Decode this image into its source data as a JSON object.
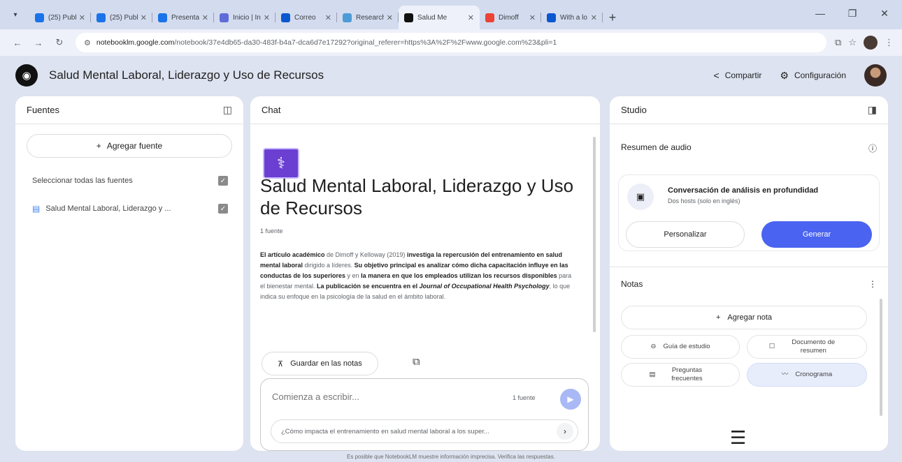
{
  "browser": {
    "tabs": [
      {
        "title": "(25) Publ",
        "color": "#1a73e8"
      },
      {
        "title": "(25) Publ",
        "color": "#1a73e8"
      },
      {
        "title": "Presenta",
        "color": "#1a73e8"
      },
      {
        "title": "Inicio | In",
        "color": "#5f6bd8"
      },
      {
        "title": "Correo",
        "color": "#0b57d0"
      },
      {
        "title": "Research",
        "color": "#4d9bd6"
      },
      {
        "title": "Salud Me",
        "color": "#111111"
      },
      {
        "title": "Dimoff",
        "color": "#ea4335"
      },
      {
        "title": "With a lo",
        "color": "#0b57d0"
      }
    ],
    "active_tab_index": 6,
    "url_host": "notebooklm.google.com",
    "url_path": "/notebook/37e4db65-da30-483f-b4a7-dca6d7e17292?original_referer=https%3A%2F%2Fwww.google.com%23&pli=1"
  },
  "header": {
    "title": "Salud Mental Laboral, Liderazgo y Uso de Recursos",
    "share_label": "Compartir",
    "settings_label": "Configuración"
  },
  "sources": {
    "title": "Fuentes",
    "add_label": "Agregar fuente",
    "select_all_label": "Seleccionar todas las fuentes",
    "items": [
      {
        "label": "Salud Mental Laboral, Liderazgo y ..."
      }
    ]
  },
  "chat": {
    "title": "Chat",
    "notebook_title": "Salud Mental Laboral, Liderazgo y Uso de Recursos",
    "source_count": "1 fuente",
    "summary": {
      "p1": "El artículo académico",
      "p2": " de Dimoff y Kelloway (2019) ",
      "p3": "investiga la repercusión del entrenamiento en salud mental laboral",
      "p4": " dirigido a líderes. ",
      "p5": "Su objetivo principal es analizar cómo dicha capacitación influye en las conductas de los superiores",
      "p6": " y en ",
      "p7": "la manera en que los empleados utilizan los recursos disponibles",
      "p8": " para el bienestar mental. ",
      "p9": "La publicación se encuentra en el ",
      "p10": "Journal of Occupational Health Psychology",
      "p11": ", lo que indica su enfoque en la psicología de la salud en el ámbito laboral."
    },
    "save_note_label": "Guardar en las notas",
    "input_placeholder": "Comienza a escribir...",
    "input_source_count": "1 fuente",
    "suggestion": "¿Cómo impacta el entrenamiento en salud mental laboral a los super..."
  },
  "studio": {
    "title": "Studio",
    "audio_title": "Resumen de audio",
    "audio_card_title": "Conversación de análisis en profundidad",
    "audio_card_sub": "Dos hosts (solo en inglés)",
    "customize_label": "Personalizar",
    "generate_label": "Generar",
    "notes_title": "Notas",
    "add_note_label": "Agregar nota",
    "chips": {
      "study_guide": "Guía de estudio",
      "summary_doc": "Documento de resumen",
      "faq": "Preguntas frecuentes",
      "timeline": "Cronograma"
    }
  },
  "footer": {
    "disclaimer": "Es posible que NotebookLM muestre información imprecisa. Verifica las respuestas."
  },
  "colors": {
    "accent": "#4a63f0",
    "page_bg": "#dde3f0",
    "panel_bg": "#ffffff"
  }
}
